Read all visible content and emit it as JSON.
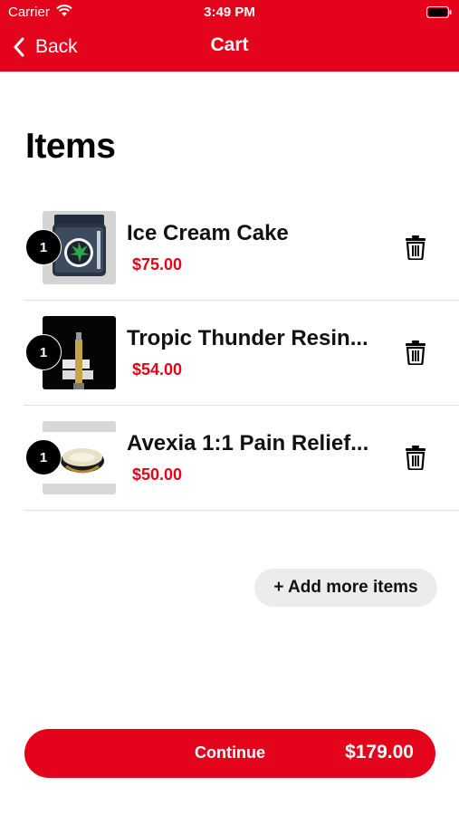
{
  "status_bar": {
    "carrier": "Carrier",
    "time": "3:49 PM"
  },
  "nav": {
    "back_label": "Back",
    "title": "Cart"
  },
  "heading": "Items",
  "items": [
    {
      "quantity": "1",
      "name": "Ice Cream Cake",
      "price": "$75.00",
      "thumbnail": "jar-product-image"
    },
    {
      "quantity": "1",
      "name": "Tropic Thunder Resin...",
      "price": "$54.00",
      "thumbnail": "cartridge-product-image"
    },
    {
      "quantity": "1",
      "name": "Avexia 1:1 Pain Relief...",
      "price": "$50.00",
      "thumbnail": "tin-product-image"
    }
  ],
  "add_more_label": "+ Add more items",
  "footer": {
    "continue_label": "Continue",
    "total": "$179.00"
  },
  "colors": {
    "brand_red": "#e3041b",
    "price_red": "#e3041b",
    "pill_gray": "#ececec"
  }
}
